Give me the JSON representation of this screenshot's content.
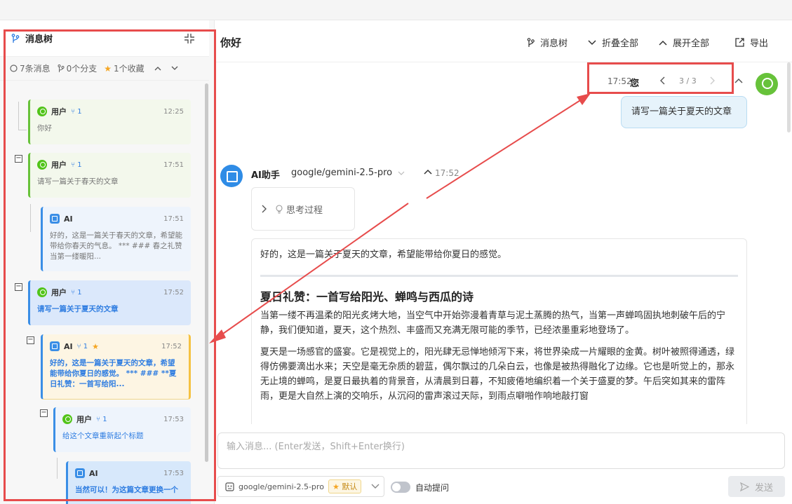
{
  "left_panel": {
    "title": "消息树",
    "stats": {
      "messages": "7条消息",
      "branches": "0个分支",
      "favorites": "1个收藏"
    },
    "nodes": [
      {
        "role": "用户",
        "branch": "1",
        "time": "12:25",
        "content": "你好"
      },
      {
        "role": "用户",
        "branch": "1",
        "time": "17:51",
        "content": "请写一篇关于春天的文章"
      },
      {
        "role": "AI",
        "time": "17:51",
        "content": "好的，这是一篇关于春天的文章，希望能带给你春天的气息。 *** ### 春之礼赞 当第一缕暖阳..."
      },
      {
        "role": "用户",
        "branch": "1",
        "time": "17:52",
        "content": "请写一篇关于夏天的文章"
      },
      {
        "role": "AI",
        "branch": "1",
        "time": "17:52",
        "content": "好的，这是一篇关于夏天的文章，希望能带给你夏日的感觉。 *** ### **夏日礼赞：一首写给阳..."
      },
      {
        "role": "用户",
        "branch": "1",
        "time": "17:53",
        "content": "给这个文章重新起个标题"
      },
      {
        "role": "AI",
        "time": "17:53",
        "content": "当然可以！为这篇文章更换一个"
      }
    ]
  },
  "header": {
    "title": "你好",
    "buttons": {
      "tree": "消息树",
      "collapse_all": "折叠全部",
      "expand_all": "展开全部",
      "export": "导出"
    }
  },
  "chat": {
    "user_msg": {
      "time": "17:52",
      "sender": "您",
      "pager": "3 / 3",
      "text": "请写一篇关于夏天的文章"
    },
    "ai_msg": {
      "name": "AI助手",
      "model": "google/gemini-2.5-pro",
      "time": "17:52",
      "thinking": "思考过程",
      "intro": "好的，这是一篇关于夏天的文章，希望能带给你夏日的感觉。",
      "heading": "夏日礼赞：一首写给阳光、蝉鸣与西瓜的诗",
      "p1": "当第一缕不再温柔的阳光炙烤大地，当空气中开始弥漫着青草与泥土蒸腾的热气，当第一声蝉鸣固执地刺破午后的宁静，我们便知道，夏天，这个热烈、丰盛而又充满无限可能的季节，已经浓墨重彩地登场了。",
      "p2": "夏天是一场感官的盛宴。它是视觉上的，阳光肆无忌惮地倾泻下来，将世界染成一片耀眼的金黄。树叶被照得通透，绿得仿佛要滴出水来；天空是毫无杂质的碧蓝，偶尔飘过的几朵白云，也像是被热得融化了边缘。它也是听觉上的，那永无止境的蝉鸣，是夏日最执着的背景音，从清晨到日暮，不知疲倦地编织着一个关于盛夏的梦。午后突如其来的雷阵雨，更是大自然上演的交响乐，从沉闷的雷声滚过天际，到雨点噼啪作响地敲打窗"
    }
  },
  "input": {
    "placeholder": "输入消息... (Enter发送，Shift+Enter换行)",
    "model": "google/gemini-2.5-pro",
    "default_tag": "默认",
    "auto_ask": "自动提问",
    "send": "发送"
  }
}
